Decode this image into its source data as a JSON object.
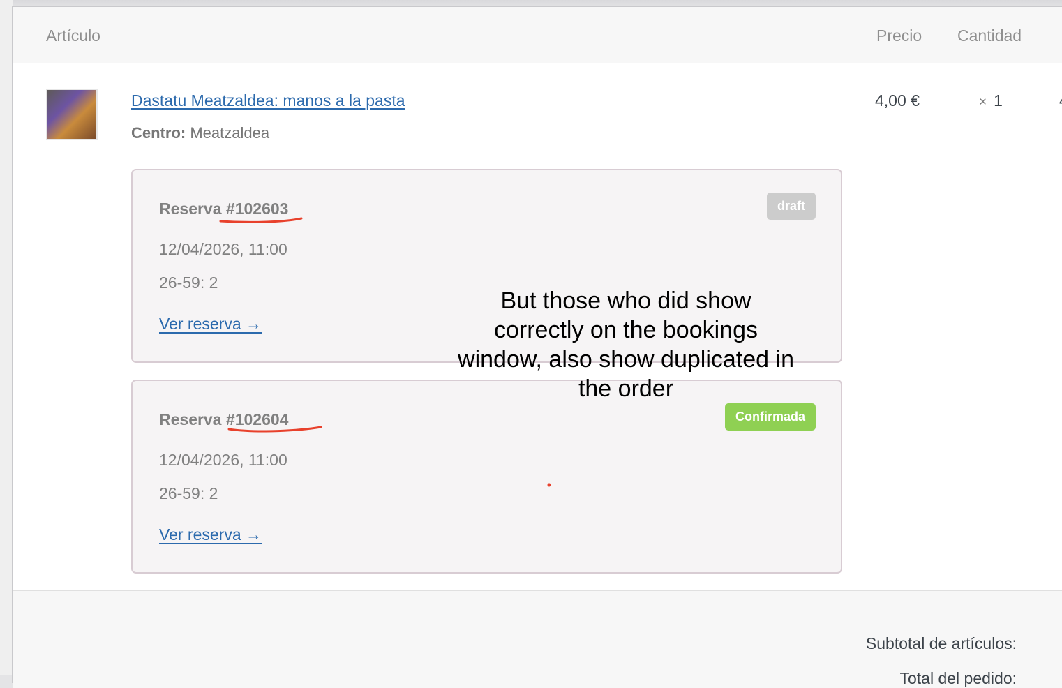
{
  "table": {
    "headers": {
      "item": "Artículo",
      "price": "Precio",
      "quantity": "Cantidad"
    }
  },
  "item": {
    "name": "Dastatu Meatzaldea: manos a la pasta",
    "meta_label": "Centro:",
    "meta_value": "Meatzaldea",
    "price": "4,00 €",
    "qty_symbol": "×",
    "qty": "1",
    "total_cut": "4"
  },
  "bookings": [
    {
      "title": "Reserva #102603",
      "date": "12/04/2026, 11:00",
      "qty": "26-59: 2",
      "link": "Ver reserva →",
      "status": "draft",
      "status_color": "#cccccc"
    },
    {
      "title": "Reserva #102604",
      "date": "12/04/2026, 11:00",
      "qty": "26-59: 2",
      "link": "Ver reserva →",
      "status": "Confirmada",
      "status_color": "#8fd053"
    }
  ],
  "footer": {
    "subtotal_label": "Subtotal de artículos:",
    "total_label": "Total del pedido:"
  },
  "annotation": {
    "text": "But those who did show correctly on the bookings window, also show duplicated in the order",
    "color": "#e8412c"
  }
}
